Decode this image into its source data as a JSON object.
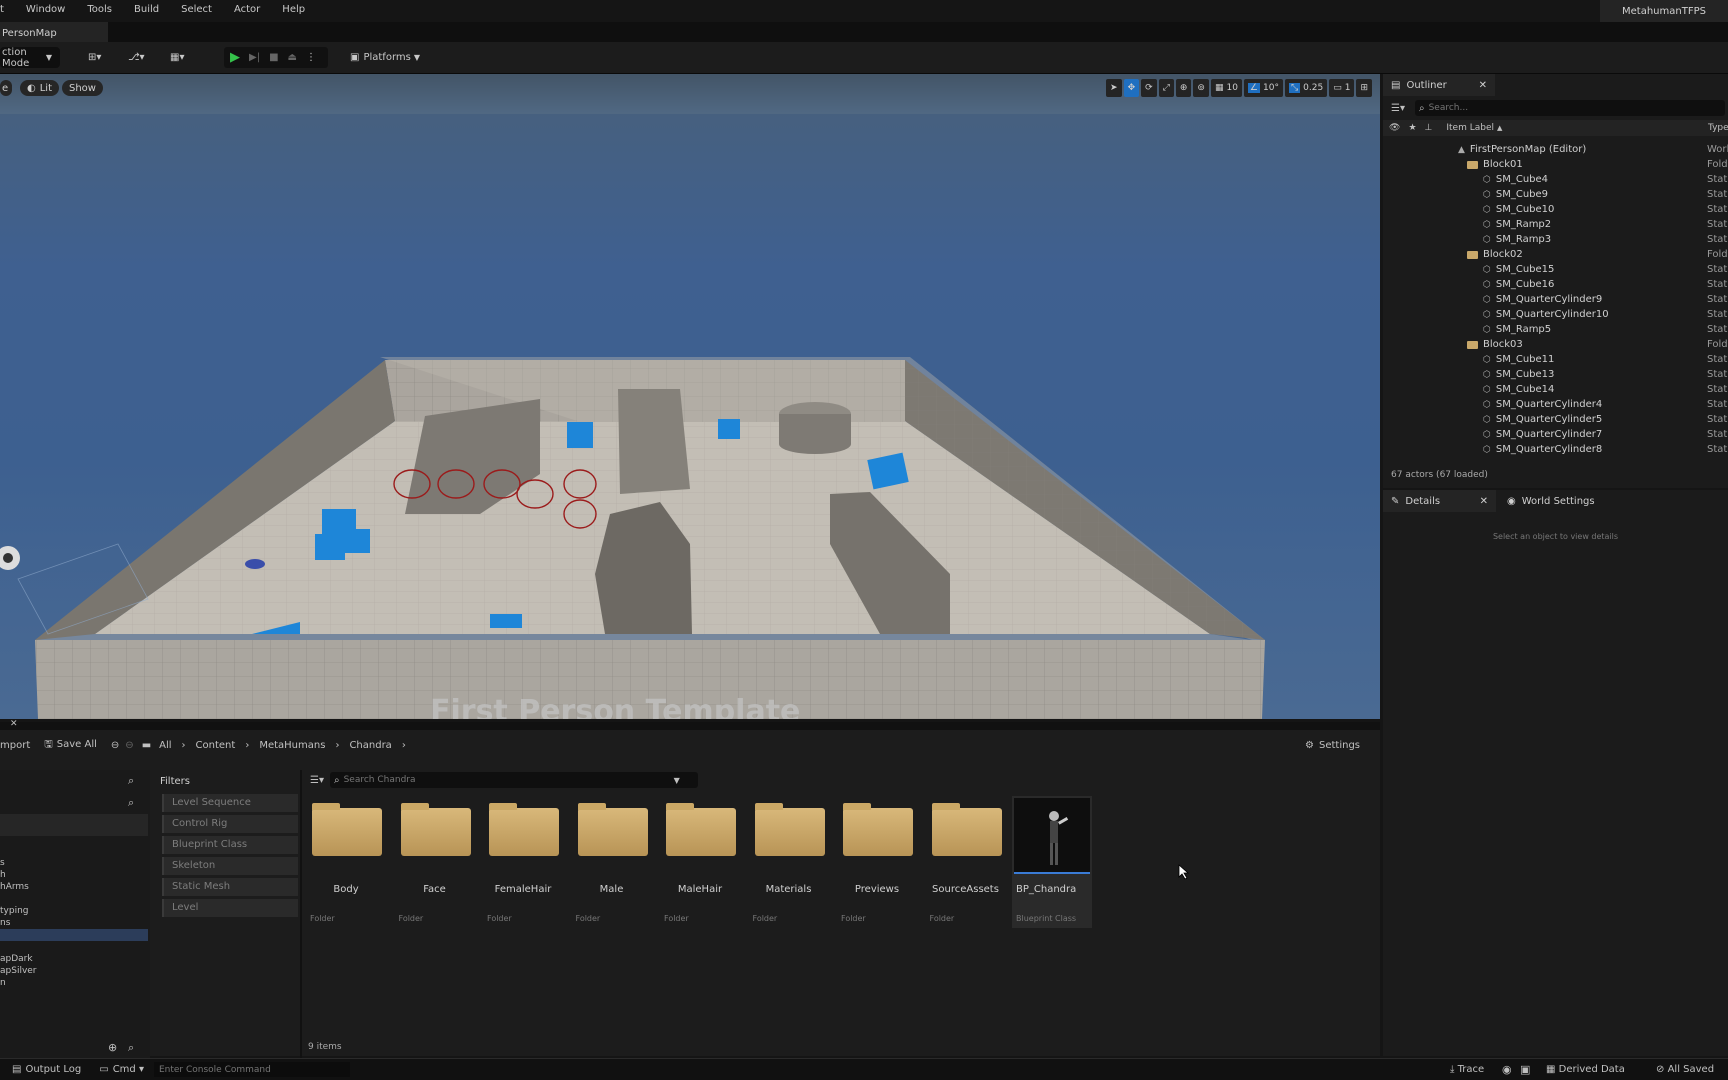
{
  "menu": [
    "t",
    "Window",
    "Tools",
    "Build",
    "Select",
    "Actor",
    "Help"
  ],
  "project_name": "MetahumanTFPS",
  "map_tab": "PersonMap",
  "toolbar": {
    "mode": "ction Mode",
    "platforms": "Platforms"
  },
  "viewport": {
    "buttons": [
      "e",
      "Lit",
      "Show"
    ],
    "snap": {
      "grid": "10",
      "rotation": "10°",
      "scale": "0.25",
      "camera": "1"
    },
    "watermark": "First Person Template"
  },
  "outliner": {
    "title": "Outliner",
    "search_placeholder": "Search...",
    "col_label": "Item Label",
    "col_type": "Type",
    "rows": [
      {
        "label": "FirstPersonMap (Editor)",
        "type": "Worl",
        "kind": "map"
      },
      {
        "label": "Block01",
        "type": "Fold",
        "kind": "folder"
      },
      {
        "label": "SM_Cube4",
        "type": "Stati",
        "kind": "mesh"
      },
      {
        "label": "SM_Cube9",
        "type": "Stati",
        "kind": "mesh"
      },
      {
        "label": "SM_Cube10",
        "type": "Stati",
        "kind": "mesh"
      },
      {
        "label": "SM_Ramp2",
        "type": "Stati",
        "kind": "mesh"
      },
      {
        "label": "SM_Ramp3",
        "type": "Stati",
        "kind": "mesh"
      },
      {
        "label": "Block02",
        "type": "Fold",
        "kind": "folder"
      },
      {
        "label": "SM_Cube15",
        "type": "Stati",
        "kind": "mesh"
      },
      {
        "label": "SM_Cube16",
        "type": "Stati",
        "kind": "mesh"
      },
      {
        "label": "SM_QuarterCylinder9",
        "type": "Stati",
        "kind": "mesh"
      },
      {
        "label": "SM_QuarterCylinder10",
        "type": "Stati",
        "kind": "mesh"
      },
      {
        "label": "SM_Ramp5",
        "type": "Stati",
        "kind": "mesh"
      },
      {
        "label": "Block03",
        "type": "Fold",
        "kind": "folder"
      },
      {
        "label": "SM_Cube11",
        "type": "Stati",
        "kind": "mesh"
      },
      {
        "label": "SM_Cube13",
        "type": "Stati",
        "kind": "mesh"
      },
      {
        "label": "SM_Cube14",
        "type": "Stati",
        "kind": "mesh"
      },
      {
        "label": "SM_QuarterCylinder4",
        "type": "Stati",
        "kind": "mesh"
      },
      {
        "label": "SM_QuarterCylinder5",
        "type": "Stati",
        "kind": "mesh"
      },
      {
        "label": "SM_QuarterCylinder7",
        "type": "Stati",
        "kind": "mesh"
      },
      {
        "label": "SM_QuarterCylinder8",
        "type": "Stati",
        "kind": "mesh"
      }
    ],
    "count": "67 actors (67 loaded)"
  },
  "details": {
    "tab1": "Details",
    "tab2": "World Settings",
    "empty": "Select an object to view details"
  },
  "content_browser": {
    "import": "mport",
    "save_all": "Save All",
    "path": [
      "All",
      "Content",
      "MetaHumans",
      "Chandra"
    ],
    "settings": "Settings",
    "filters_title": "Filters",
    "filters": [
      "Level Sequence",
      "Control Rig",
      "Blueprint Class",
      "Skeleton",
      "Static Mesh",
      "Level"
    ],
    "search_placeholder": "Search Chandra",
    "tree": [
      "s",
      "h",
      "hArms",
      "typing",
      "ns",
      "apDark",
      "apSilver",
      "n"
    ],
    "items": [
      {
        "name": "Body",
        "type": "Folder"
      },
      {
        "name": "Face",
        "type": "Folder"
      },
      {
        "name": "FemaleHair",
        "type": "Folder"
      },
      {
        "name": "Male",
        "type": "Folder"
      },
      {
        "name": "MaleHair",
        "type": "Folder"
      },
      {
        "name": "Materials",
        "type": "Folder"
      },
      {
        "name": "Previews",
        "type": "Folder"
      },
      {
        "name": "SourceAssets",
        "type": "Folder"
      },
      {
        "name": "BP_Chandra",
        "type": "Blueprint Class"
      }
    ],
    "count": "9 items"
  },
  "status": {
    "output_log": "Output Log",
    "cmd": "Cmd",
    "console_placeholder": "Enter Console Command",
    "trace": "Trace",
    "derived": "Derived Data",
    "saved": "All Saved"
  },
  "colors": {
    "accent_blue": "#1f8fe8",
    "cube_blue": "#1e86d8",
    "play_green": "#35c24b"
  }
}
